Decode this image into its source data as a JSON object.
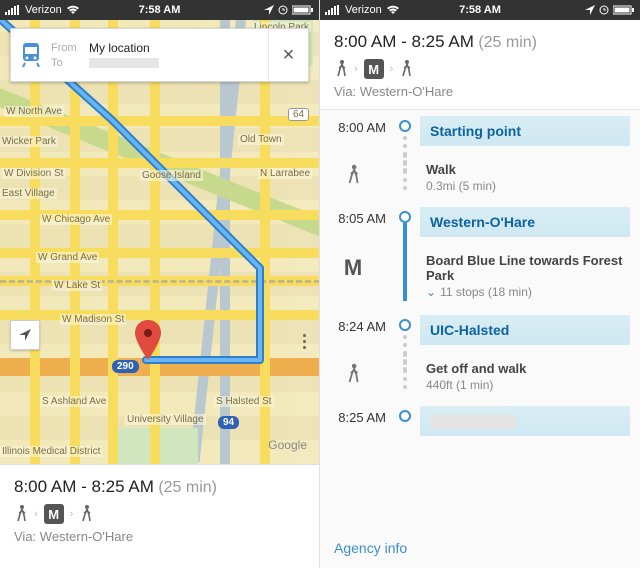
{
  "statusbar": {
    "carrier": "Verizon",
    "time": "7:58 AM"
  },
  "search": {
    "from_label": "From",
    "from_value": "My location",
    "to_label": "To"
  },
  "map": {
    "labels": {
      "lincoln": "Lincoln Park",
      "north": "W North Ave",
      "wicker": "Wicker Park",
      "division": "W Division St",
      "oldtown": "Old Town",
      "goose": "Goose Island",
      "larrabee": "N Larrabee",
      "east": "East Village",
      "chicago": "W Chicago Ave",
      "grand": "W Grand Ave",
      "lake": "W Lake St",
      "madison": "W Madison St",
      "ashland": "S Ashland Ave",
      "university": "University Village",
      "medical": "Illinois Medical District",
      "halsted": "S Halsted St",
      "route64": "64",
      "i290": "290",
      "i94": "94",
      "google": "Google"
    }
  },
  "summary": {
    "start": "8:00 AM",
    "end": "8:25 AM",
    "duration": "(25 min)",
    "via_label": "Via:",
    "via_value": "Western-O'Hare"
  },
  "steps": [
    {
      "time": "8:00 AM",
      "title": "Starting point",
      "type": "station"
    },
    {
      "type": "walk",
      "detail": "Walk",
      "sub": "0.3mi (5 min)"
    },
    {
      "time": "8:05 AM",
      "title": "Western-O'Hare",
      "type": "station"
    },
    {
      "type": "transit",
      "detail": "Board Blue Line towards Forest Park",
      "stops": "11 stops (18 min)"
    },
    {
      "time": "8:24 AM",
      "title": "UIC-Halsted",
      "type": "station"
    },
    {
      "type": "walk",
      "detail": "Get off and walk",
      "sub": "440ft (1 min)"
    },
    {
      "time": "8:25 AM",
      "title": "",
      "type": "station",
      "redacted": true
    }
  ],
  "agency_link": "Agency info",
  "metro_glyph": "M"
}
